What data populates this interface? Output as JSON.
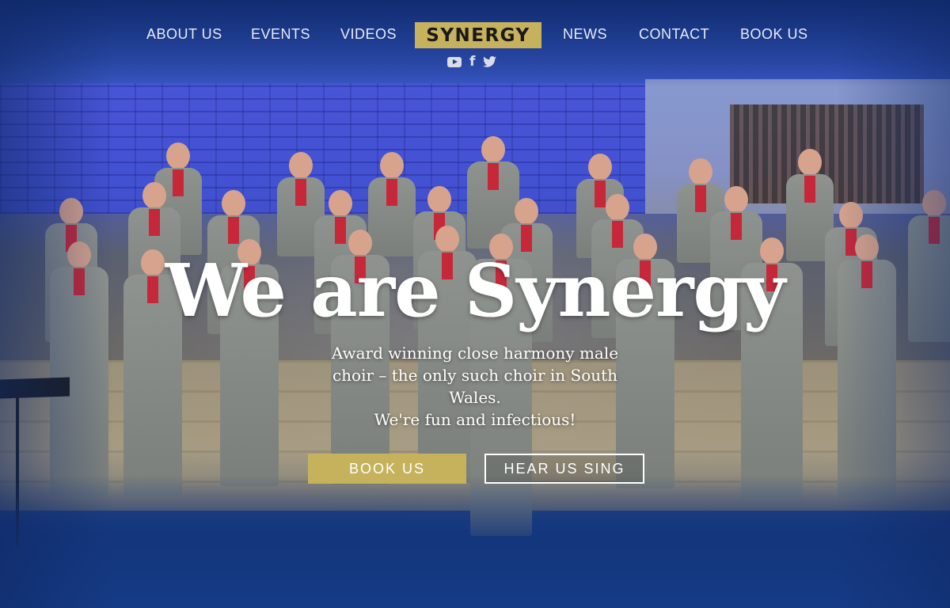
{
  "nav": {
    "left": [
      "ABOUT US",
      "EVENTS",
      "VIDEOS"
    ],
    "logo": "SYNERGY",
    "right": [
      "NEWS",
      "CONTACT",
      "BOOK US"
    ]
  },
  "social": [
    "youtube-icon",
    "facebook-icon",
    "twitter-icon"
  ],
  "hero": {
    "headline": "We are Synergy",
    "subtitle_lines": [
      "Award winning close harmony male",
      "choir – the only such choir in South",
      "Wales.",
      "We're fun and infectious!"
    ],
    "buttons": {
      "book": "BOOK US",
      "hear": "HEAR US SING"
    }
  },
  "colors": {
    "accent_gold": "#c6b25c",
    "blue_overlay": "#163b86"
  }
}
